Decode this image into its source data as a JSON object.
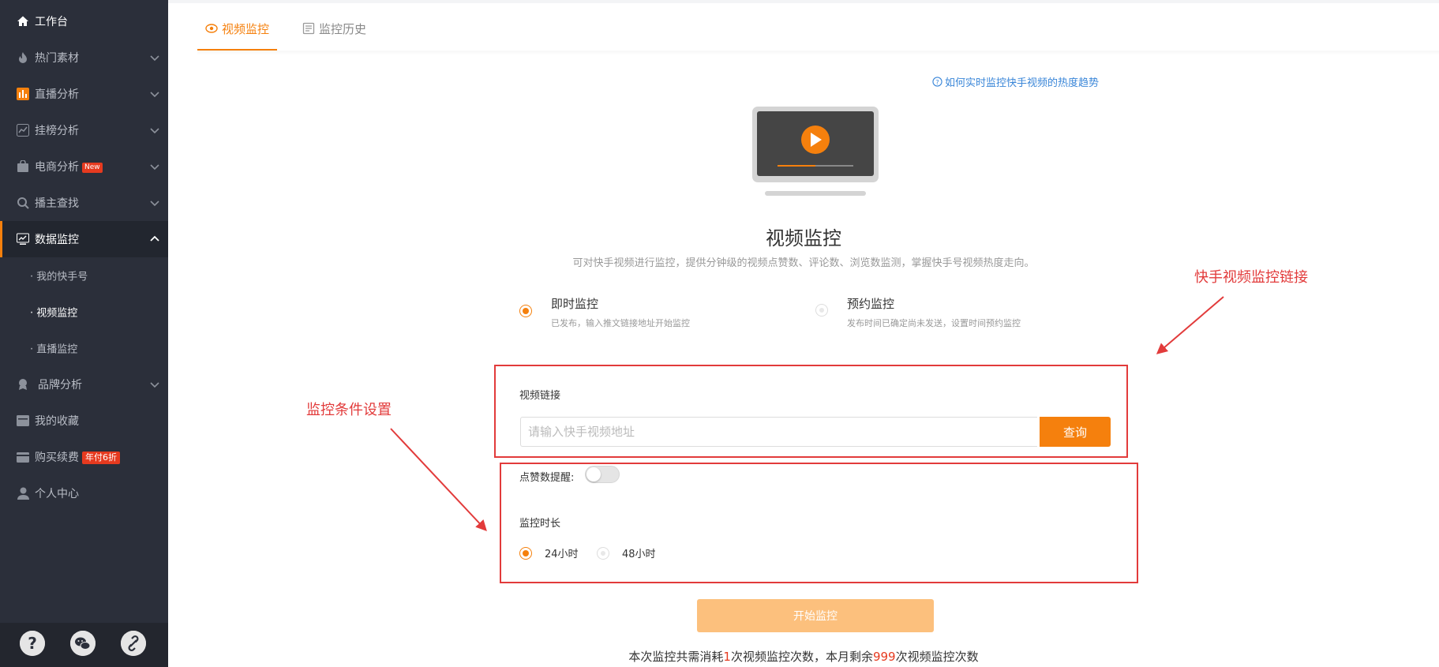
{
  "sidebar": {
    "home": {
      "label": "工作台",
      "icon": "home-icon"
    },
    "items": [
      {
        "label": "热门素材",
        "icon": "fire-icon"
      },
      {
        "label": "直播分析",
        "icon": "bar-chart-icon"
      },
      {
        "label": "挂榜分析",
        "icon": "trend-icon"
      },
      {
        "label": "电商分析",
        "icon": "shopping-bag-icon",
        "badge": "New"
      },
      {
        "label": "播主查找",
        "icon": "search-icon"
      },
      {
        "label": "数据监控",
        "icon": "monitor-chart-icon"
      }
    ],
    "sub_items": [
      {
        "label": "· 我的快手号"
      },
      {
        "label": "· 视频监控"
      },
      {
        "label": "· 直播监控"
      }
    ],
    "items_after": [
      {
        "label": "品牌分析",
        "icon": "brand-icon"
      },
      {
        "label": "我的收藏",
        "icon": "bookmark-icon"
      },
      {
        "label": "购买续费",
        "icon": "card-icon",
        "badge": "年付6折"
      },
      {
        "label": "个人中心",
        "icon": "user-icon"
      }
    ],
    "bottom_icons": [
      "help-icon",
      "wechat-icon",
      "link-icon"
    ],
    "accent": "#f5800d"
  },
  "tabs": [
    {
      "label": "视频监控",
      "icon": "eye-icon"
    },
    {
      "label": "监控历史",
      "icon": "history-icon"
    }
  ],
  "help_link": "如何实时监控快手视频的热度趋势",
  "page_title": "视频监控",
  "page_subtitle": "可对快手视频进行监控，提供分钟级的视频点赞数、评论数、浏览数监测，掌握快手号视频热度走向。",
  "modes": [
    {
      "title": "即时监控",
      "desc": "已发布，输入推文链接地址开始监控",
      "selected": true
    },
    {
      "title": "预约监控",
      "desc": "发布时间已确定尚未发送，设置时间预约监控",
      "selected": false
    }
  ],
  "url_field": {
    "label": "视频链接",
    "placeholder": "请输入快手视频地址",
    "value": "",
    "button": "查询"
  },
  "like_alert": {
    "label": "点赞数提醒:",
    "enabled": false
  },
  "duration": {
    "label": "监控时长",
    "options": [
      "24小时",
      "48小时"
    ],
    "selected": "24小时"
  },
  "start_button": "开始监控",
  "footnote": {
    "p1": "本次监控共需消耗",
    "n1": "1",
    "p2": "次视频监控次数，本月剩余",
    "n2": "999",
    "p3": "次视频监控次数"
  },
  "annotations": {
    "left": "监控条件设置",
    "right": "快手视频监控链接"
  },
  "colors": {
    "accent": "#f5800d",
    "annotation": "#e23b3b",
    "sidebar_bg": "#2b2f3a"
  }
}
